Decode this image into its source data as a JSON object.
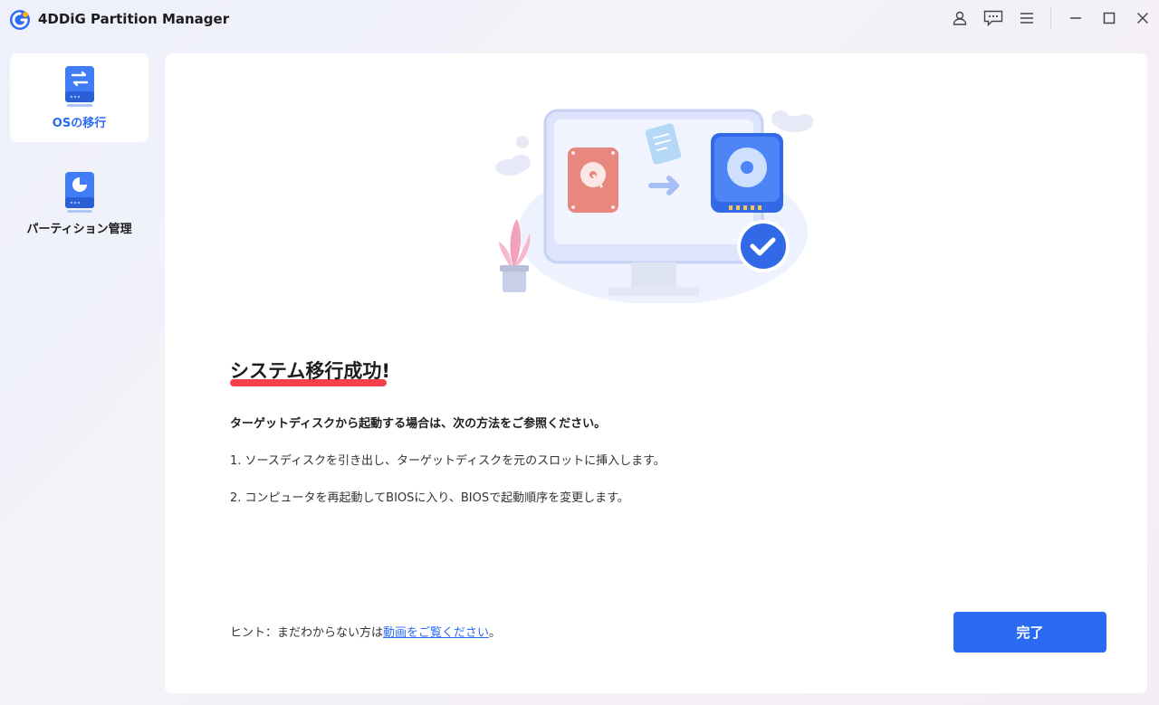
{
  "app": {
    "title": "4DDiG Partition Manager"
  },
  "sidebar": {
    "items": [
      {
        "label": "OSの移行",
        "icon": "migrate-disk-icon",
        "active": true
      },
      {
        "label": "パーティション管理",
        "icon": "partition-disk-icon",
        "active": false
      }
    ]
  },
  "window_controls": [
    "user-icon",
    "feedback-icon",
    "menu-icon",
    "minimize-icon",
    "maximize-icon",
    "close-icon"
  ],
  "main": {
    "heading": "システム移行成功!",
    "instructions_title": "ターゲットディスクから起動する場合は、次の方法をご参照ください。",
    "steps": [
      "1. ソースディスクを引き出し、ターゲットディスクを元のスロットに挿入します。",
      "2. コンピュータを再起動してBIOSに入り、BIOSで起動順序を変更します。"
    ],
    "hint_prefix": "ヒント：まだわからない方は",
    "hint_link": "動画をご覧ください",
    "hint_suffix": "。",
    "done_button": "完了"
  },
  "colors": {
    "accent": "#2b6bf3",
    "underline": "#f6414d"
  }
}
